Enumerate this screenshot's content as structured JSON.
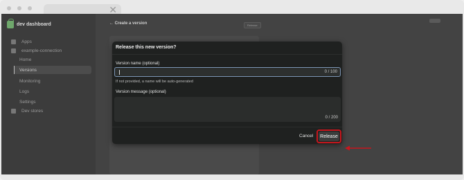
{
  "sidebar": {
    "brand": "dev dashboard",
    "items": [
      {
        "label": "Apps"
      },
      {
        "label": "example-connection"
      },
      {
        "label": "Home"
      },
      {
        "label": "Versions"
      },
      {
        "label": "Monitoring"
      },
      {
        "label": "Logs"
      },
      {
        "label": "Settings"
      },
      {
        "label": "Dev stores"
      }
    ]
  },
  "page": {
    "title": "Create a version",
    "release_label": "Release"
  },
  "modal": {
    "title": "Release this new version?",
    "name_label": "Version name (optional)",
    "name_value": "",
    "name_counter": "0 / 100",
    "name_hint": "If not provided, a name will be auto-generated",
    "message_label": "Version message (optional)",
    "message_value": "",
    "message_counter": "0 / 200",
    "cancel_label": "Cancel",
    "release_label": "Release"
  },
  "colors": {
    "highlight": "#c8161d",
    "focus_ring": "#7c95b5",
    "brand": "#6fa86c"
  }
}
